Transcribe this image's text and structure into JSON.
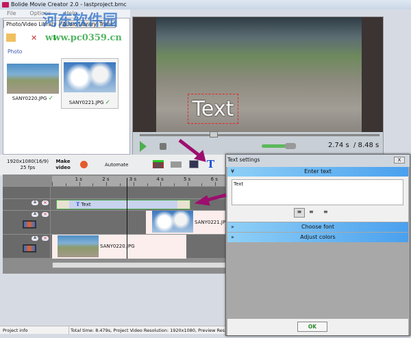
{
  "window": {
    "title": "Bolide Movie Creator 2.0 - lastproject.bmc"
  },
  "menu": [
    "File",
    "Options",
    "Help"
  ],
  "library": {
    "tabs": [
      "Photo/Video Library",
      "Audio Library",
      "Trans"
    ],
    "section": "Photo",
    "items": [
      {
        "name": "SANY0220.JPG",
        "used": true
      },
      {
        "name": "SANY0221.JPG",
        "used": true,
        "selected": true
      }
    ]
  },
  "player": {
    "overlay_text": "Text",
    "current": "2.74 s",
    "total": "/ 8.48 s",
    "seek_fraction": 0.32,
    "volume_fraction": 0.8
  },
  "toolbar": {
    "resolution": "1920x1080(16/9)",
    "fps": "25 fps",
    "make_video": "Make video",
    "automate": "Automate",
    "icons": [
      "film-transition-icon",
      "blank-clip-icon",
      "photo-icon",
      "text-icon"
    ]
  },
  "timeline": {
    "ruler": [
      "1 s",
      "2 s",
      "3 s",
      "4 s",
      "5 s",
      "6 s"
    ],
    "playhead_seconds": 2.74,
    "text_clip": "Text",
    "clips": [
      "SANY0221.JPG",
      "SANY0220.JPG"
    ]
  },
  "status": {
    "label": "Project info",
    "info": "Total time: 8.479s,   Project Video Resolution:   1920x1080,   Preview Res"
  },
  "dialog": {
    "title": "Text settings",
    "close": "X",
    "enter_text": "Enter text",
    "text_value": "Text",
    "align": [
      "align-left",
      "align-center",
      "align-right"
    ],
    "choose_font": "Choose font",
    "adjust_colors": "Adjust colors",
    "ok": "OK"
  },
  "watermark": {
    "cn": "河东软件园",
    "url": "www.pc0359.cn"
  },
  "colors": {
    "accent": "#4aa0ee",
    "arrow": "#9c0e6e",
    "progress": "#5cb85c"
  }
}
